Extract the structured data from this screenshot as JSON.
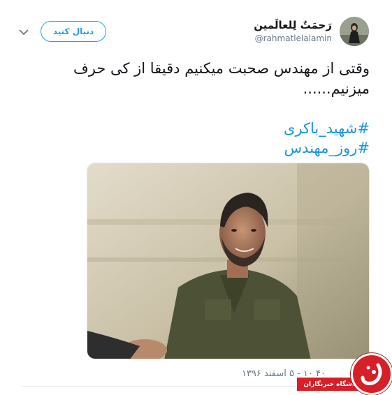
{
  "tweet": {
    "author": {
      "display_name": "رَحمَتٌ لِلعالَمین",
      "handle": "@rahmatlelalamin"
    },
    "follow_button_label": "دنبال کنید",
    "text": "وقتی از مهندس صحبت میکنیم دقیقا از کی حرف میزنیم......",
    "hashtags": [
      "#شهید_باکری",
      "#روز_مهندس"
    ],
    "timestamp": "۴۰ ۱۰ - ۵ اسفند ۱۳۹۶"
  },
  "watermark": {
    "text": "باشگاه خبرنگاران",
    "color": "#d61f26"
  },
  "icons": {
    "menu": "chevron-down-icon"
  },
  "colors": {
    "link": "#1b95e0",
    "follow_border": "#1da1f2",
    "muted": "#657786"
  }
}
